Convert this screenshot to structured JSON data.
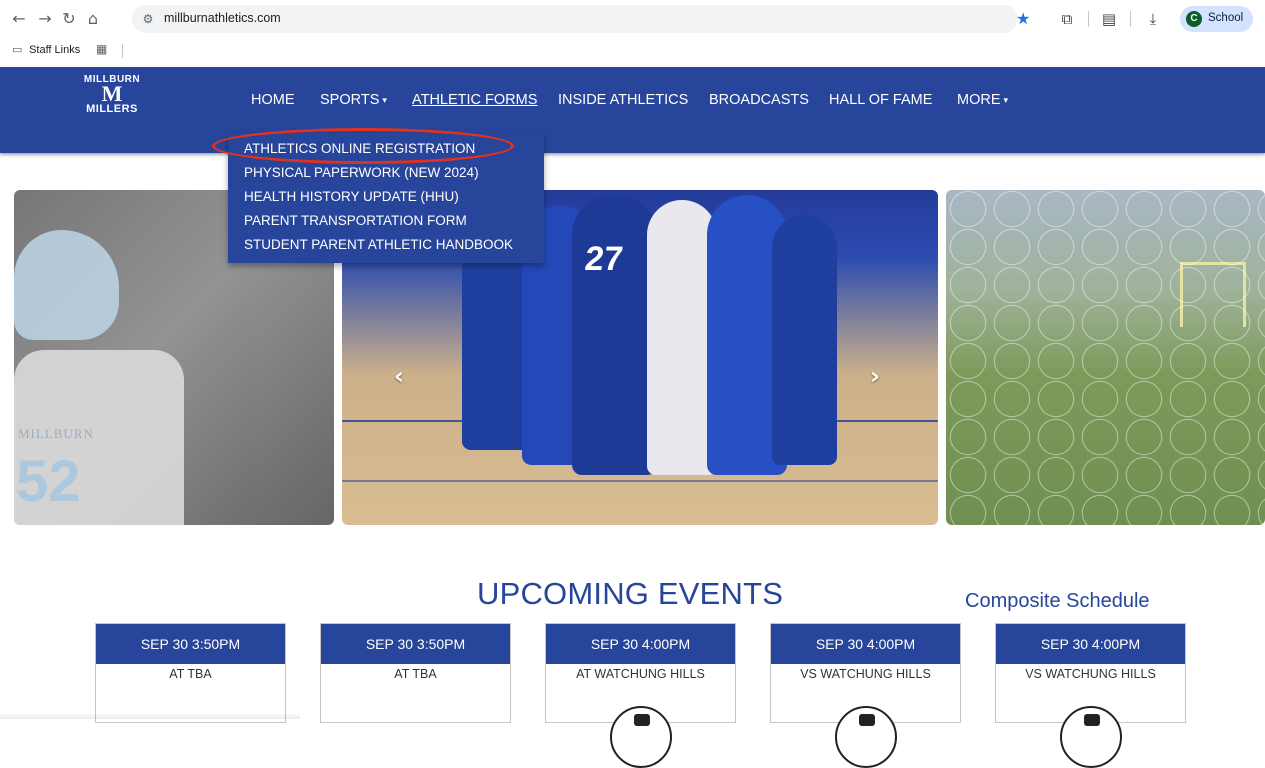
{
  "browser": {
    "url": "millburnathletics.com",
    "profile_initial": "C",
    "profile_name": "School",
    "bookmark_folder": "Staff Links"
  },
  "site": {
    "logo": {
      "top": "MILLBURN",
      "letter": "M",
      "bottom": "MILLERS"
    },
    "nav": [
      {
        "label": "HOME"
      },
      {
        "label": "SPORTS",
        "caret": "▾"
      },
      {
        "label": "ATHLETIC FORMS"
      },
      {
        "label": "INSIDE ATHLETICS"
      },
      {
        "label": "BROADCASTS"
      },
      {
        "label": "HALL OF FAME"
      },
      {
        "label": "MORE",
        "caret": "▾"
      }
    ],
    "dropdown": [
      {
        "label": "ATHLETICS ONLINE REGISTRATION"
      },
      {
        "label": "PHYSICAL PAPERWORK (NEW 2024)"
      },
      {
        "label": "HEALTH HISTORY UPDATE (HHU)"
      },
      {
        "label": "PARENT TRANSPORTATION FORM"
      },
      {
        "label": "STUDENT PARENT ATHLETIC HANDBOOK"
      }
    ]
  },
  "carousel": {
    "slide_left_text": "MILLBURN",
    "slide_left_number": "52",
    "slide_center_number": "27",
    "prev": "‹",
    "next": "›"
  },
  "events": {
    "heading": "UPCOMING EVENTS",
    "composite_link": "Composite Schedule",
    "items": [
      {
        "date": "SEP 30 3:50PM",
        "opponent": "AT TBA"
      },
      {
        "date": "SEP 30 3:50PM",
        "opponent": "AT TBA"
      },
      {
        "date": "SEP 30 4:00PM",
        "opponent": "AT WATCHUNG HILLS"
      },
      {
        "date": "SEP 30 4:00PM",
        "opponent": "VS WATCHUNG HILLS"
      },
      {
        "date": "SEP 30 4:00PM",
        "opponent": "VS WATCHUNG HILLS"
      }
    ]
  },
  "colors": {
    "brand_blue": "#27459b",
    "highlight_red": "#e0321f"
  }
}
